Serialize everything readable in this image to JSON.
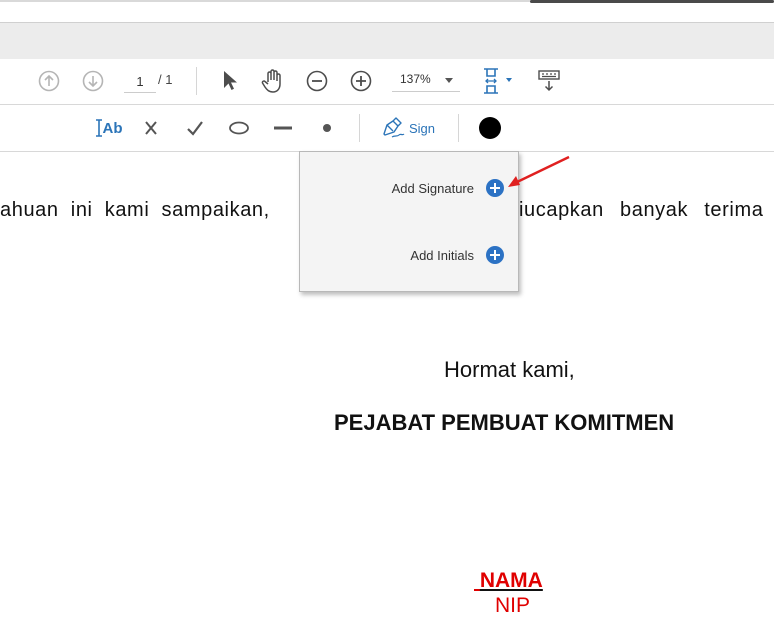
{
  "toolbar": {
    "prev_page_icon": "arrow-up-circle-icon",
    "next_page_icon": "arrow-down-circle-icon",
    "page_current": "1",
    "page_total": "/ 1",
    "zoom_level": "137%",
    "tools": [
      "select-cursor-icon",
      "hand-icon",
      "zoom-out-icon",
      "zoom-in-icon",
      "fit-page-icon",
      "keyboard-icon"
    ]
  },
  "sign_toolbar": {
    "text_tool_label": "Ab",
    "sign_label": "Sign",
    "color": "#000000",
    "accent": "#2b74b8"
  },
  "menu": {
    "items": [
      {
        "label": "Add Signature"
      },
      {
        "label": "Add Initials"
      }
    ]
  },
  "document": {
    "body_left": "ahuan ini kami sampaikan,",
    "body_right": "iucapkan banyak terima",
    "closing": "Hormat kami,",
    "position": "PEJABAT PEMBUAT KOMITMEN",
    "name": "NAMA",
    "nip": "NIP",
    "name_color": "#e00000"
  }
}
